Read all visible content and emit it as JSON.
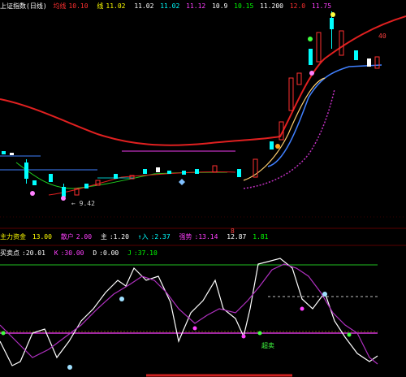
{
  "main_panel": {
    "title": "上证指数(日线)",
    "indicators": [
      {
        "label": "均线",
        "value": "10.10",
        "color": "#ff3030"
      },
      {
        "label": "线",
        "value": "11.02",
        "color": "#ffff00"
      },
      {
        "label": "",
        "value": "11.02",
        "color": "#ffffff"
      },
      {
        "label": "",
        "value": "11.02",
        "color": "#00ffff"
      },
      {
        "label": "",
        "value": "11.12",
        "color": "#ff40ff"
      },
      {
        "label": "",
        "value": "10.9",
        "color": "#ffffff"
      },
      {
        "label": "",
        "value": "10.15",
        "color": "#00ff00"
      },
      {
        "label": "",
        "value": "11.200",
        "color": "#ffffff"
      },
      {
        "label": "",
        "value": "12.0",
        "color": "#ff3030"
      },
      {
        "label": "",
        "value": "11.75",
        "color": "#ff40ff"
      }
    ],
    "low_label": "← 9.42",
    "high_marker": "40",
    "bottom_marker": "8"
  },
  "middle_panel": {
    "indicators": [
      {
        "label": "主力资金",
        "value": "13.00",
        "color": "#ffff00"
      },
      {
        "label": "散户",
        "value": "2.00",
        "color": "#ff40ff"
      },
      {
        "label": "主",
        "value": "1.20",
        "color": "#ffffff"
      },
      {
        "label": "↑入",
        "value": "2.37",
        "color": "#00ffff"
      },
      {
        "label": "强势",
        "value": "13.14",
        "color": "#ff40ff"
      },
      {
        "label": "",
        "value": "12.87",
        "color": "#ffffff"
      },
      {
        "label": "",
        "value": "1.81",
        "color": "#00ff00"
      }
    ]
  },
  "lower_panel": {
    "indicators": [
      {
        "label": "买卖点",
        "value": "20.01",
        "color": "#ffffff"
      },
      {
        "label": "K",
        "value": "30.00",
        "color": "#ff40ff"
      },
      {
        "label": "D",
        "value": "0.00",
        "color": "#ffffff"
      },
      {
        "label": "J",
        "value": "37.10",
        "color": "#00ff00"
      }
    ],
    "bottom_label": "超卖"
  }
}
